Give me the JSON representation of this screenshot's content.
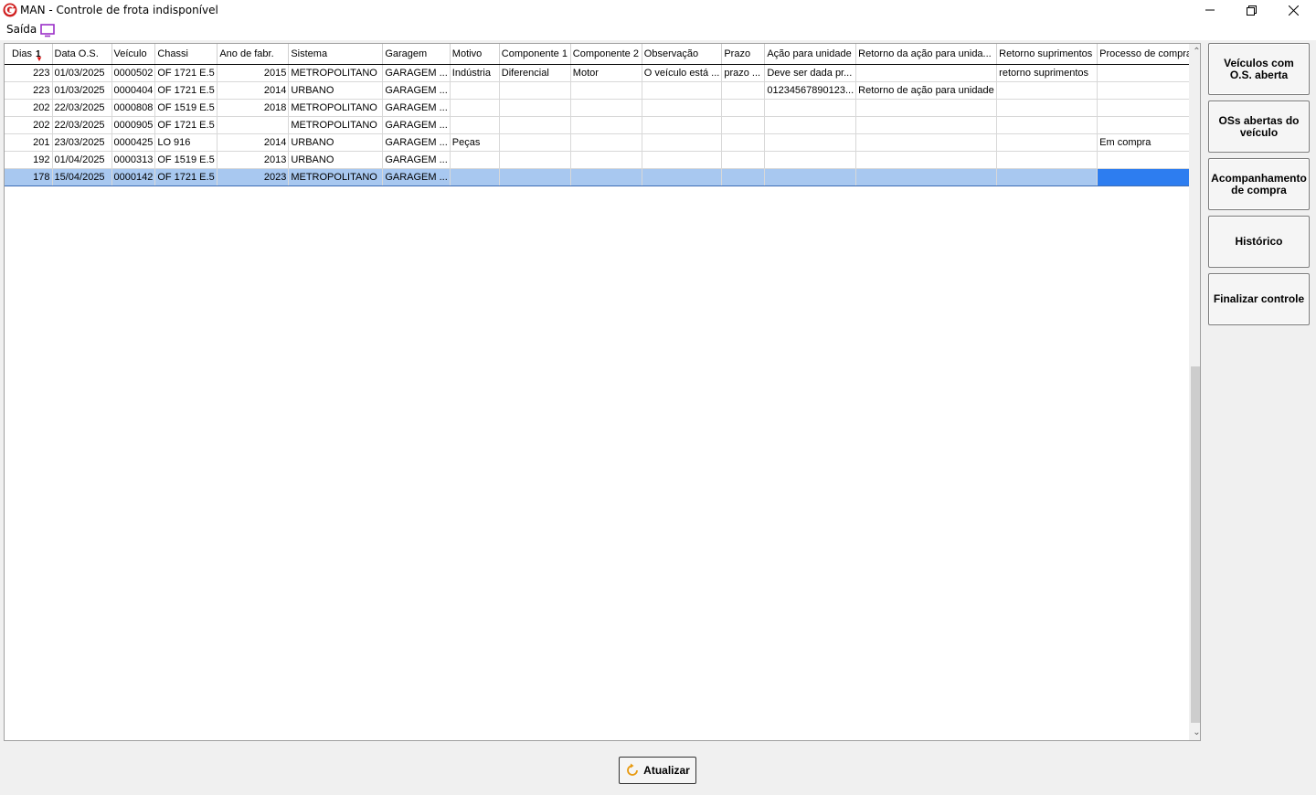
{
  "window": {
    "title": "MAN - Controle de frota indisponível"
  },
  "menu": {
    "items": [
      {
        "label": "Saída"
      }
    ],
    "icon": "monitor-icon",
    "icon_color": "#9b30c8"
  },
  "table": {
    "sort_indicator": "1",
    "columns": [
      {
        "label": "Dias"
      },
      {
        "label": "Data O.S."
      },
      {
        "label": "Veículo"
      },
      {
        "label": "Chassi"
      },
      {
        "label": "Ano de fabr."
      },
      {
        "label": "Sistema"
      },
      {
        "label": "Garagem"
      },
      {
        "label": "Motivo"
      },
      {
        "label": "Componente 1"
      },
      {
        "label": "Componente 2"
      },
      {
        "label": "Observação"
      },
      {
        "label": "Prazo"
      },
      {
        "label": "Ação para unidade"
      },
      {
        "label": "Retorno da ação para unida..."
      },
      {
        "label": "Retorno suprimentos"
      },
      {
        "label": "Processo de compra"
      }
    ],
    "rows": [
      [
        "223",
        "01/03/2025",
        "0000502",
        "OF 1721 E.5",
        "2015",
        "METROPOLITANO",
        "GARAGEM ...",
        "Indústria",
        "Diferencial",
        "Motor",
        "O veículo está ...",
        "prazo ...",
        "Deve ser dada pr...",
        "",
        "retorno suprimentos",
        ""
      ],
      [
        "223",
        "01/03/2025",
        "0000404",
        "OF 1721 E.5",
        "2014",
        "URBANO",
        "GARAGEM ...",
        "",
        "",
        "",
        "",
        "",
        "01234567890123...",
        "Retorno de ação para unidade",
        "",
        ""
      ],
      [
        "202",
        "22/03/2025",
        "0000808",
        "OF 1519 E.5",
        "2018",
        "METROPOLITANO",
        "GARAGEM ...",
        "",
        "",
        "",
        "",
        "",
        "",
        "",
        "",
        ""
      ],
      [
        "202",
        "22/03/2025",
        "0000905",
        "OF 1721 E.5",
        "",
        "METROPOLITANO",
        "GARAGEM ...",
        "",
        "",
        "",
        "",
        "",
        "",
        "",
        "",
        ""
      ],
      [
        "201",
        "23/03/2025",
        "0000425",
        "LO 916",
        "2014",
        "URBANO",
        "GARAGEM ...",
        "Peças",
        "",
        "",
        "",
        "",
        "",
        "",
        "",
        "Em compra"
      ],
      [
        "192",
        "01/04/2025",
        "0000313",
        "OF 1519 E.5",
        "2013",
        "URBANO",
        "GARAGEM ...",
        "",
        "",
        "",
        "",
        "",
        "",
        "",
        "",
        ""
      ],
      [
        "178",
        "15/04/2025",
        "0000142",
        "OF 1721 E.5",
        "2023",
        "METROPOLITANO",
        "GARAGEM ...",
        "",
        "",
        "",
        "",
        "",
        "",
        "",
        "",
        ""
      ]
    ],
    "selected_row": 6
  },
  "side_buttons": [
    {
      "label": "Veículos com O.S. aberta"
    },
    {
      "label": "OSs abertas do veículo"
    },
    {
      "label": "Acompanhamento de compra"
    },
    {
      "label": "Histórico"
    },
    {
      "label": "Finalizar controle"
    }
  ],
  "footer": {
    "refresh_label": "Atualizar",
    "refresh_icon": "refresh-icon",
    "refresh_icon_color": "#e89a10"
  },
  "colors": {
    "logo": "#d02020",
    "selection": "#a8c8f0",
    "focus_cell": "#2d7df0"
  }
}
